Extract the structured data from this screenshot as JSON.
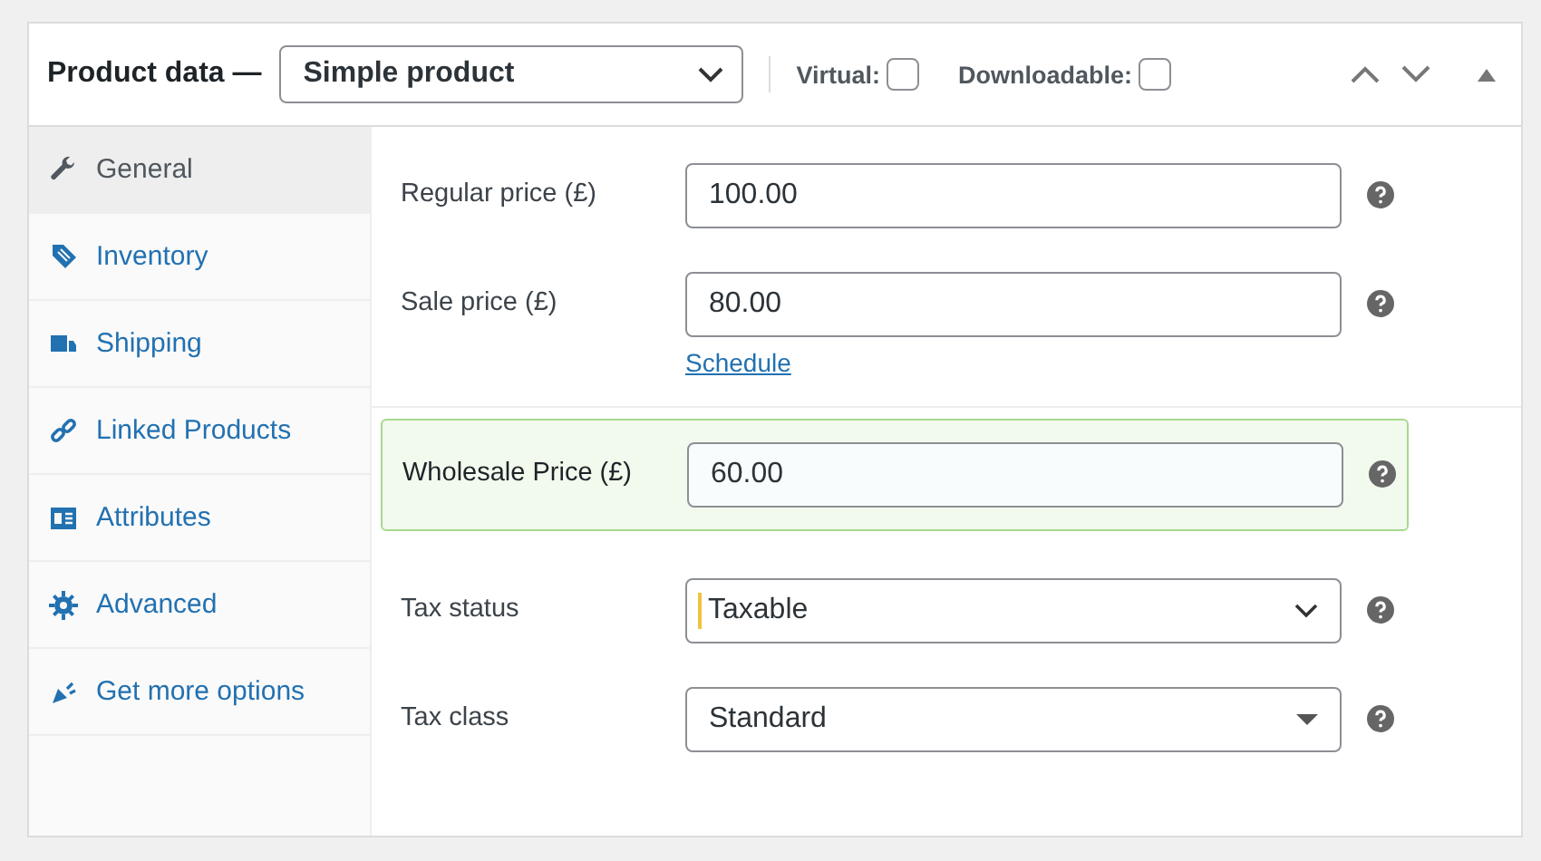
{
  "header": {
    "title": "Product data —",
    "product_type": {
      "value": "Simple product"
    },
    "options": [
      {
        "label": "Virtual:",
        "checked": false
      },
      {
        "label": "Downloadable:",
        "checked": false
      }
    ]
  },
  "tabs": [
    {
      "label": "General",
      "selected": true
    },
    {
      "label": "Inventory",
      "selected": false
    },
    {
      "label": "Shipping",
      "selected": false
    },
    {
      "label": "Linked Products",
      "selected": false
    },
    {
      "label": "Attributes",
      "selected": false
    },
    {
      "label": "Advanced",
      "selected": false
    },
    {
      "label": "Get more options",
      "selected": false
    }
  ],
  "groups": [
    {
      "highlighted": false,
      "fields": [
        {
          "kind": "text",
          "label": "Regular price (£)",
          "value": "100.00",
          "focused": false
        },
        {
          "kind": "text",
          "label": "Sale price (£)",
          "value": "80.00",
          "focused": false,
          "link": "Schedule"
        }
      ]
    },
    {
      "highlighted": true,
      "fields": [
        {
          "kind": "text",
          "label": "Wholesale Price (£)",
          "value": "60.00",
          "focused": false
        }
      ]
    },
    {
      "highlighted": false,
      "fields": [
        {
          "kind": "select",
          "label": "Tax status",
          "value": "Taxable",
          "focused": true
        },
        {
          "kind": "dropdown",
          "label": "Tax class",
          "value": "Standard",
          "focused": false
        }
      ]
    }
  ]
}
